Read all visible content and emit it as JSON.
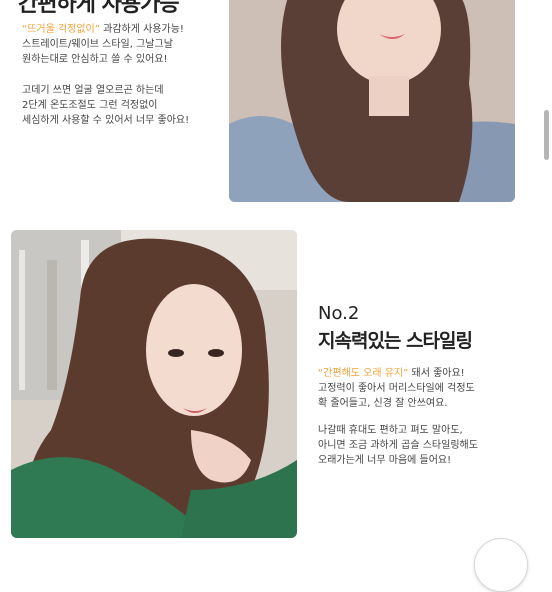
{
  "section1": {
    "heading": "간편하게 사용가능",
    "p1_highlight": "“뜨거울 걱정없이”",
    "p1_line1_rest": " 과감하게 사용가능!",
    "p1_line2": "스트레이트/웨이브 스타일, 그날그날",
    "p1_line3": "원하는대로 안심하고 쓸 수 있어요!",
    "p2_line1": "고데기 쓰면 얼굴 열오르곤 하는데",
    "p2_line2": "2단계 온도조절도 그런 걱정없이",
    "p2_line3": "세심하게 사용할 수 있어서 너무 좋아요!"
  },
  "section2": {
    "number": "No.2",
    "heading": "지속력있는 스타일링",
    "p1_highlight": "“간편해도 오래 유지”",
    "p1_line1_rest": " 돼서 좋아요!",
    "p1_line2": "고정력이 좋아서 머리스타일에 걱정도",
    "p1_line3": "확 줄어들고, 신경 잘 안쓰여요.",
    "p2_line1": "나갈때 휴대도 편하고 펴도 말아도,",
    "p2_line2": "아니면 조금 과하게 곱슬 스타일링해도",
    "p2_line3": "오래가는게 너무 마음에 들어요!"
  },
  "colors": {
    "highlight": "#f2a23a",
    "heading": "#222222",
    "body_text": "#444444"
  }
}
